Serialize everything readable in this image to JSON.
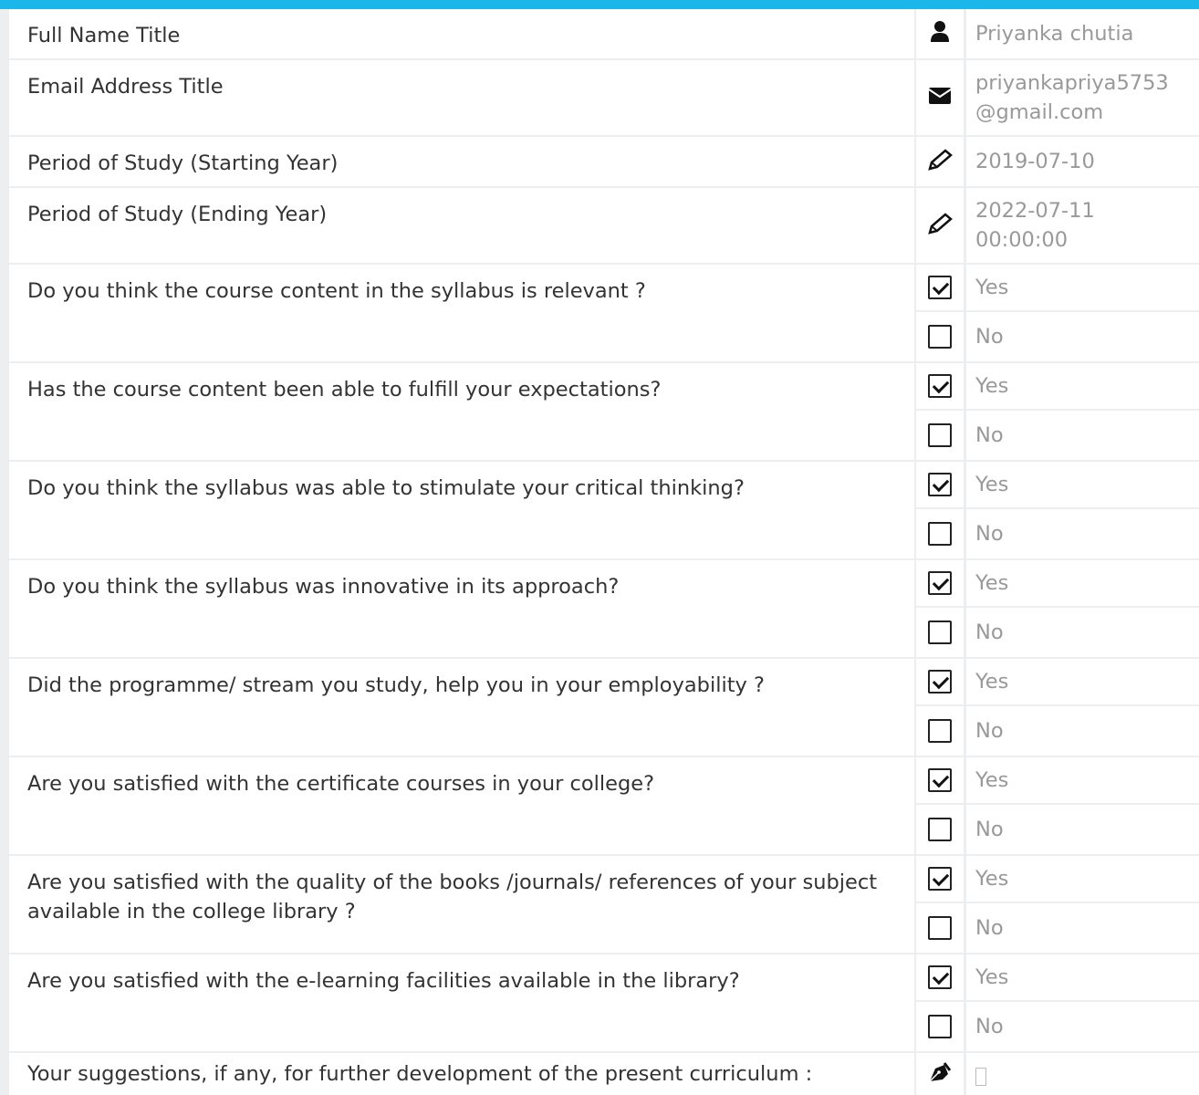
{
  "profile": {
    "full_name_label": "Full Name Title",
    "full_name_value": "Priyanka chutia",
    "full_name_icon": "user-icon",
    "email_label": "Email Address Title",
    "email_value": "priyankapriya5753@gmail.com",
    "email_icon": "envelope-icon",
    "start_label": "Period of Study (Starting Year)",
    "start_value": "2019-07-10",
    "start_icon": "pencil-icon",
    "end_label": "Period of Study (Ending Year)",
    "end_value": "2022-07-11 00:00:00",
    "end_icon": "pencil-icon"
  },
  "questions": [
    {
      "text": "Do you think the course content in the syllabus is relevant ?",
      "yes": "Yes",
      "no": "No",
      "selected": "Yes"
    },
    {
      "text": "Has the course content been able to fulfill your expectations?",
      "yes": "Yes",
      "no": "No",
      "selected": "Yes"
    },
    {
      "text": "Do you think the syllabus was able to stimulate your critical thinking?",
      "yes": "Yes",
      "no": "No",
      "selected": "Yes"
    },
    {
      "text": "Do you think the syllabus was innovative in its approach?",
      "yes": "Yes",
      "no": "No",
      "selected": "Yes"
    },
    {
      "text": "Did the programme/ stream you study, help you in your employability ?",
      "yes": "Yes",
      "no": "No",
      "selected": "Yes"
    },
    {
      "text": "Are you satisfied with the certificate courses in your college?",
      "yes": "Yes",
      "no": "No",
      "selected": "Yes"
    },
    {
      "text": "Are you satisfied with the quality of the books /journals/ references of your subject available in the college library ?",
      "yes": "Yes",
      "no": "No",
      "selected": "Yes"
    },
    {
      "text": "Are you satisfied with the e-learning facilities available in the library?",
      "yes": "Yes",
      "no": "No",
      "selected": "Yes"
    }
  ],
  "suggestions": {
    "label": "Your suggestions, if any, for further development of the present curriculum :",
    "icon": "pen-nib-icon"
  },
  "colors": {
    "accent": "#1ab7ea",
    "border": "#eceeef",
    "label_text": "#333333",
    "value_text": "#999999"
  }
}
